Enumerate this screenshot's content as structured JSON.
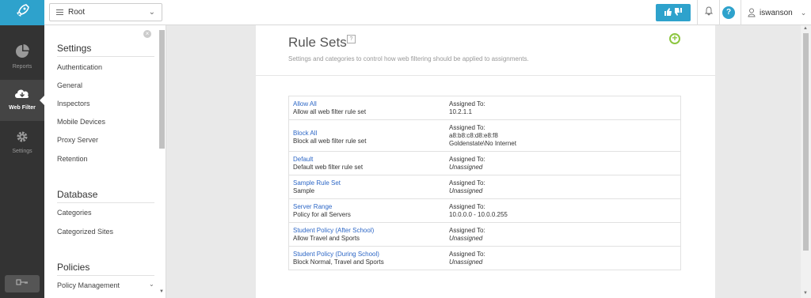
{
  "topbar": {
    "scope_value": "Root",
    "user_name": "iswanson"
  },
  "leftnav": {
    "items": [
      {
        "label": "Reports"
      },
      {
        "label": "Web Filter"
      },
      {
        "label": "Settings"
      }
    ]
  },
  "sidebar": {
    "sections": [
      {
        "heading": "Settings",
        "links": [
          "Authentication",
          "General",
          "Inspectors",
          "Mobile Devices",
          "Proxy Server",
          "Retention"
        ]
      },
      {
        "heading": "Database",
        "links": [
          "Categories",
          "Categorized Sites"
        ]
      },
      {
        "heading": "Policies",
        "links": [
          "Policy Management"
        ]
      }
    ]
  },
  "main": {
    "title": "Rule Sets",
    "subtitle": "Settings and categories to control how web filtering should be applied to assignments.",
    "assigned_label": "Assigned To:",
    "rule_sets": [
      {
        "name": "Allow All",
        "desc": "Allow all web filter rule set",
        "assigned": [
          "10.2.1.1"
        ],
        "unassigned": false
      },
      {
        "name": "Block All",
        "desc": "Block all web filter rule set",
        "assigned": [
          "a8:b8:c8:d8:e8:f8",
          "Goldenstate\\No Internet"
        ],
        "unassigned": false
      },
      {
        "name": "Default",
        "desc": "Default web filter rule set",
        "assigned": [
          "Unassigned"
        ],
        "unassigned": true
      },
      {
        "name": "Sample Rule Set",
        "desc": "Sample",
        "assigned": [
          "Unassigned"
        ],
        "unassigned": true
      },
      {
        "name": "Server Range",
        "desc": "Policy for all Servers",
        "assigned": [
          "10.0.0.0 - 10.0.0.255"
        ],
        "unassigned": false
      },
      {
        "name": "Student Policy (After School)",
        "desc": "Allow Travel and Sports",
        "assigned": [
          "Unassigned"
        ],
        "unassigned": true
      },
      {
        "name": "Student Policy (During School)",
        "desc": "Block Normal, Travel and Sports",
        "assigned": [
          "Unassigned"
        ],
        "unassigned": true
      }
    ]
  },
  "icons": {
    "logo": "rocket-icon",
    "reports": "pie-chart-icon",
    "webfilter": "cloud-icon",
    "settings": "gear-icon",
    "feedback": "thumbs-icon",
    "bell": "bell-icon",
    "help": "question-icon",
    "user": "user-icon"
  },
  "colors": {
    "accent": "#2ea2cc",
    "link": "#2d67c6",
    "add": "#8cc63f",
    "nav_bg": "#333333"
  }
}
